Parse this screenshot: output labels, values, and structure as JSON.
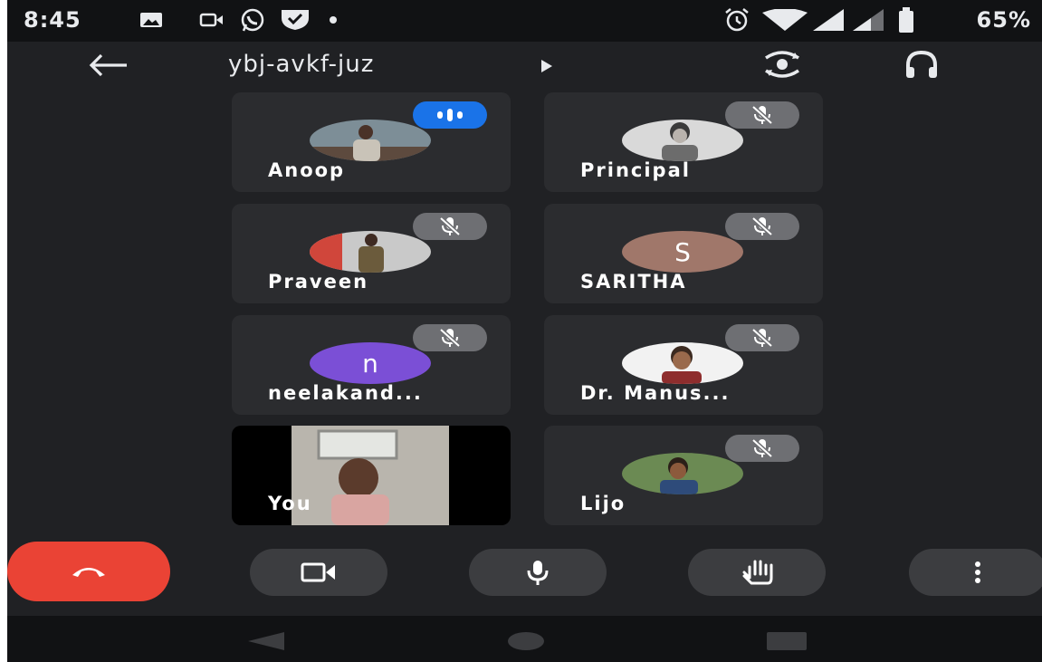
{
  "status_bar": {
    "time": "8:45",
    "battery_percent": "65%",
    "icons": [
      "image-icon",
      "video-icon",
      "whatsapp-icon",
      "shield-icon",
      "dot-icon",
      "alarm-icon",
      "wifi-icon",
      "signal-icon",
      "signal-icon",
      "battery-icon"
    ]
  },
  "header": {
    "meeting_code": "ybj-avkf-juz",
    "back_icon": "arrow-left-icon",
    "code_chevron_icon": "play-right-icon",
    "switch_camera_icon": "camera-switch-icon",
    "audio_output_icon": "headphones-icon"
  },
  "participants": [
    {
      "name": "Anoop",
      "avatar": "photo",
      "status": "speaking"
    },
    {
      "name": "Principal",
      "avatar": "photo",
      "status": "muted"
    },
    {
      "name": "Praveen",
      "avatar": "photo",
      "status": "muted"
    },
    {
      "name": "SARITHA",
      "avatar": "letter",
      "initial": "S",
      "color": "#a0776a",
      "status": "muted"
    },
    {
      "name": "neelakand...",
      "avatar": "letter",
      "initial": "n",
      "color": "#7b4fd6",
      "status": "muted"
    },
    {
      "name": "Dr. Manus...",
      "avatar": "photo",
      "status": "muted"
    },
    {
      "name": "You",
      "avatar": "video",
      "status": "self"
    },
    {
      "name": "Lijo",
      "avatar": "photo",
      "status": "muted"
    }
  ],
  "controls": {
    "end_call_icon": "end-call-icon",
    "camera_icon": "video-camera-icon",
    "mic_icon": "microphone-icon",
    "raise_hand_icon": "hand-icon",
    "more_icon": "more-vertical-icon"
  },
  "colors": {
    "background": "#202124",
    "tile": "#2b2c2f",
    "end_call": "#ea4335",
    "speaking": "#1a73e8",
    "mute_badge": "#6e6f73"
  }
}
